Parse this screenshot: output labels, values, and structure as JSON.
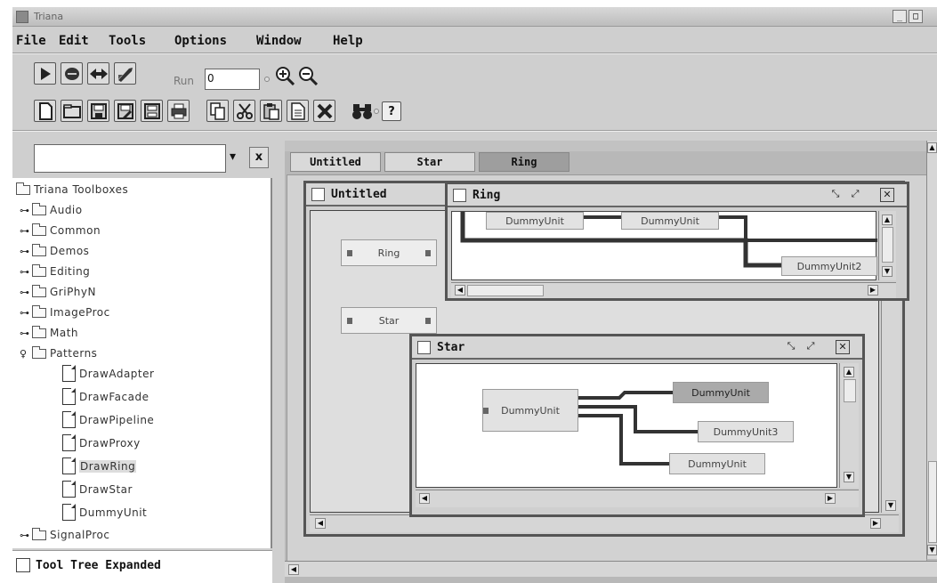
{
  "window": {
    "title": "Triana",
    "controls": [
      "_",
      "□"
    ]
  },
  "menubar": [
    "File",
    "Edit",
    "Tools",
    "Options",
    "Window",
    "Help"
  ],
  "toolbar": {
    "run_label": "Run",
    "run_value": "0"
  },
  "search": {
    "value": "",
    "dropdown_glyph": "▾",
    "clear_glyph": "x"
  },
  "tree": {
    "root": "Triana Toolboxes",
    "folders": [
      "Audio",
      "Common",
      "Demos",
      "Editing",
      "GriPhyN",
      "ImageProc",
      "Math"
    ],
    "expanded_folder": "Patterns",
    "children": [
      "DrawAdapter",
      "DrawFacade",
      "DrawPipeline",
      "DrawProxy",
      "DrawRing",
      "DrawStar",
      "DummyUnit"
    ],
    "selected": "DrawRing",
    "last_folder": "SignalProc"
  },
  "tool_tree_expanded_label": "Tool Tree Expanded",
  "tabs": [
    "Untitled",
    "Star",
    "Ring"
  ],
  "active_tab": "Ring",
  "untitled_window": {
    "title": "Untitled",
    "units": [
      "Ring",
      "Star"
    ]
  },
  "ring_window": {
    "title": "Ring",
    "units": [
      "DummyUnit",
      "DummyUnit",
      "DummyUnit2"
    ]
  },
  "star_window": {
    "title": "Star",
    "units": [
      "DummyUnit",
      "DummyUnit",
      "DummyUnit3",
      "DummyUnit"
    ]
  }
}
